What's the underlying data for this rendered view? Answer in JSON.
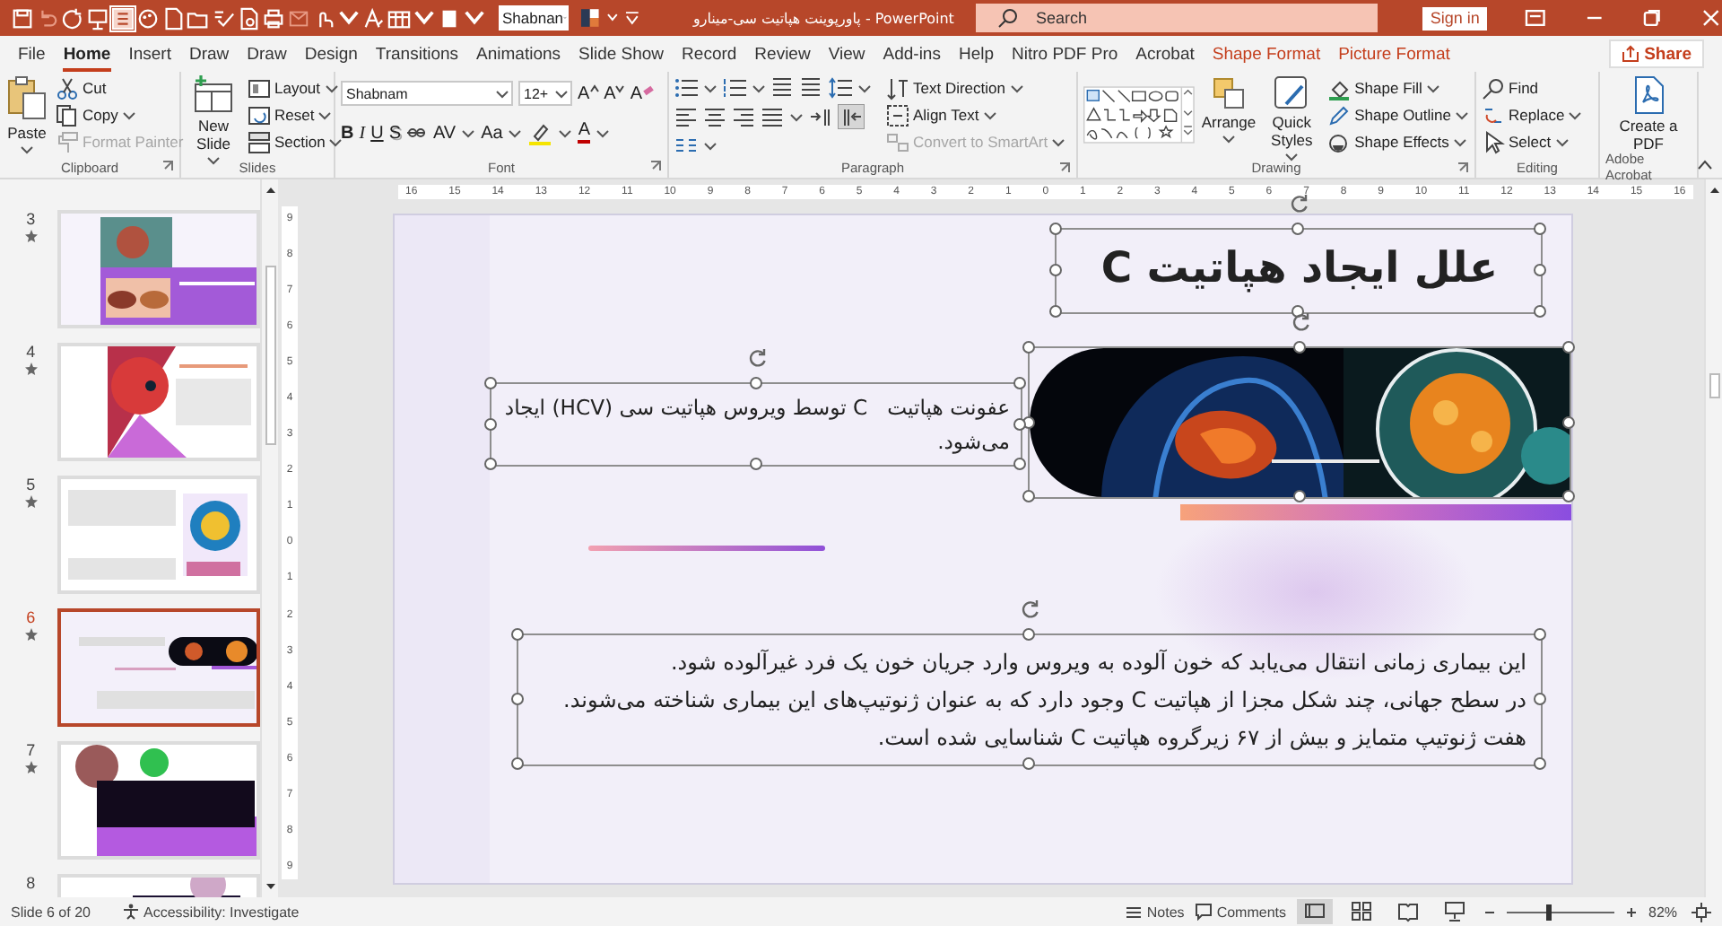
{
  "title_bar": {
    "font_box": "Shabnan",
    "document_title": "پاورپوینت هپاتیت سی-مینارو - PowerPoint",
    "search_placeholder": "Search",
    "sign_in": "Sign in"
  },
  "tabs": [
    {
      "label": "File",
      "selected": false,
      "kind": "normal"
    },
    {
      "label": "Home",
      "selected": true,
      "kind": "normal"
    },
    {
      "label": "Insert",
      "selected": false,
      "kind": "normal"
    },
    {
      "label": "Draw",
      "selected": false,
      "kind": "normal"
    },
    {
      "label": "Draw",
      "selected": false,
      "kind": "normal"
    },
    {
      "label": "Design",
      "selected": false,
      "kind": "normal"
    },
    {
      "label": "Transitions",
      "selected": false,
      "kind": "normal"
    },
    {
      "label": "Animations",
      "selected": false,
      "kind": "normal"
    },
    {
      "label": "Slide Show",
      "selected": false,
      "kind": "normal"
    },
    {
      "label": "Record",
      "selected": false,
      "kind": "normal"
    },
    {
      "label": "Review",
      "selected": false,
      "kind": "normal"
    },
    {
      "label": "View",
      "selected": false,
      "kind": "normal"
    },
    {
      "label": "Add-ins",
      "selected": false,
      "kind": "normal"
    },
    {
      "label": "Help",
      "selected": false,
      "kind": "normal"
    },
    {
      "label": "Nitro PDF Pro",
      "selected": false,
      "kind": "normal"
    },
    {
      "label": "Acrobat",
      "selected": false,
      "kind": "normal"
    },
    {
      "label": "Shape Format",
      "selected": false,
      "kind": "contextual"
    },
    {
      "label": "Picture Format",
      "selected": false,
      "kind": "contextual"
    }
  ],
  "share": "Share",
  "ribbon": {
    "groups": [
      {
        "kind": "clipboard",
        "label": "Clipboard",
        "paste": "Paste",
        "items": [
          {
            "label": "Cut",
            "disabled": false
          },
          {
            "label": "Copy",
            "disabled": false
          },
          {
            "label": "Format Painter",
            "disabled": true
          }
        ]
      },
      {
        "kind": "slides",
        "label": "Slides",
        "new_slide": "New Slide",
        "items": [
          {
            "label": "Layout",
            "disabled": false
          },
          {
            "label": "Reset",
            "disabled": false
          },
          {
            "label": "Section",
            "disabled": false
          }
        ]
      },
      {
        "kind": "font",
        "label": "Font",
        "font": "Shabnam",
        "size": "12+",
        "row1_buttons": [
          "A",
          "A",
          "A"
        ],
        "format_buttons": [
          "B",
          "I",
          "U",
          "S",
          "AV",
          "Aa"
        ],
        "font_color": "A"
      },
      {
        "kind": "paragraph",
        "label": "Paragraph",
        "items": [
          {
            "label": "Text Direction",
            "disabled": false
          },
          {
            "label": "Align Text",
            "disabled": false
          },
          {
            "label": "Convert to SmartArt",
            "disabled": true
          }
        ]
      },
      {
        "kind": "drawing",
        "label": "Drawing",
        "arrange": "Arrange",
        "quick_styles": "Quick Styles",
        "items": [
          {
            "label": "Shape Fill",
            "disabled": false
          },
          {
            "label": "Shape Outline",
            "disabled": false
          },
          {
            "label": "Shape Effects",
            "disabled": false
          }
        ]
      },
      {
        "kind": "editing",
        "label": "Editing",
        "items": [
          {
            "label": "Find",
            "disabled": false
          },
          {
            "label": "Replace",
            "disabled": false
          },
          {
            "label": "Select",
            "disabled": false
          }
        ]
      },
      {
        "kind": "acrobat",
        "label": "Adobe Acrobat",
        "button": "Create a PDF"
      }
    ]
  },
  "slides_panel": {
    "thumbnails": [
      {
        "number": "3",
        "animated": true,
        "selected": false
      },
      {
        "number": "4",
        "animated": true,
        "selected": false
      },
      {
        "number": "5",
        "animated": true,
        "selected": false
      },
      {
        "number": "6",
        "animated": true,
        "selected": true
      },
      {
        "number": "7",
        "animated": true,
        "selected": false
      },
      {
        "number": "8",
        "selected": false
      }
    ]
  },
  "rulers": {
    "horizontal": [
      "16",
      "15",
      "14",
      "13",
      "12",
      "11",
      "10",
      "9",
      "8",
      "7",
      "6",
      "5",
      "4",
      "3",
      "2",
      "1",
      "0",
      "1",
      "2",
      "3",
      "4",
      "5",
      "6",
      "7",
      "8",
      "9",
      "10",
      "11",
      "12",
      "13",
      "14",
      "15",
      "16"
    ],
    "vertical": [
      "9",
      "8",
      "7",
      "6",
      "5",
      "4",
      "3",
      "2",
      "1",
      "0",
      "1",
      "2",
      "3",
      "4",
      "5",
      "6",
      "7",
      "8",
      "9"
    ]
  },
  "slide": {
    "title": "علل ایجاد هپاتیت C",
    "intro": "عفونت هپاتیت   C توسط ویروس هپاتیت سی (HCV) ایجاد می‌شود.",
    "body": [
      "این بیماری زمانی انتقال می‌یابد که خون آلوده به ویروس وارد جریان خون یک فرد غیرآلوده شود.",
      "در سطح جهانی، چند شکل مجزا از هپاتیت C وجود دارد که به عنوان ژنوتیپ‌های این بیماری شناخته می‌شوند.",
      "هفت ژنوتیپ متمایز و بیش از ۶۷ زیرگروه هپاتیت C شناسایی شده است."
    ]
  },
  "status_bar": {
    "slide_info": "Slide 6 of 20",
    "accessibility": "Accessibility: Investigate",
    "notes": "Notes",
    "comments": "Comments",
    "views": [
      {
        "selected": true
      },
      {
        "selected": false
      },
      {
        "selected": false
      },
      {
        "selected": false
      }
    ],
    "zoom": {
      "level": 0.38
    },
    "zoom_reading": "82%"
  }
}
